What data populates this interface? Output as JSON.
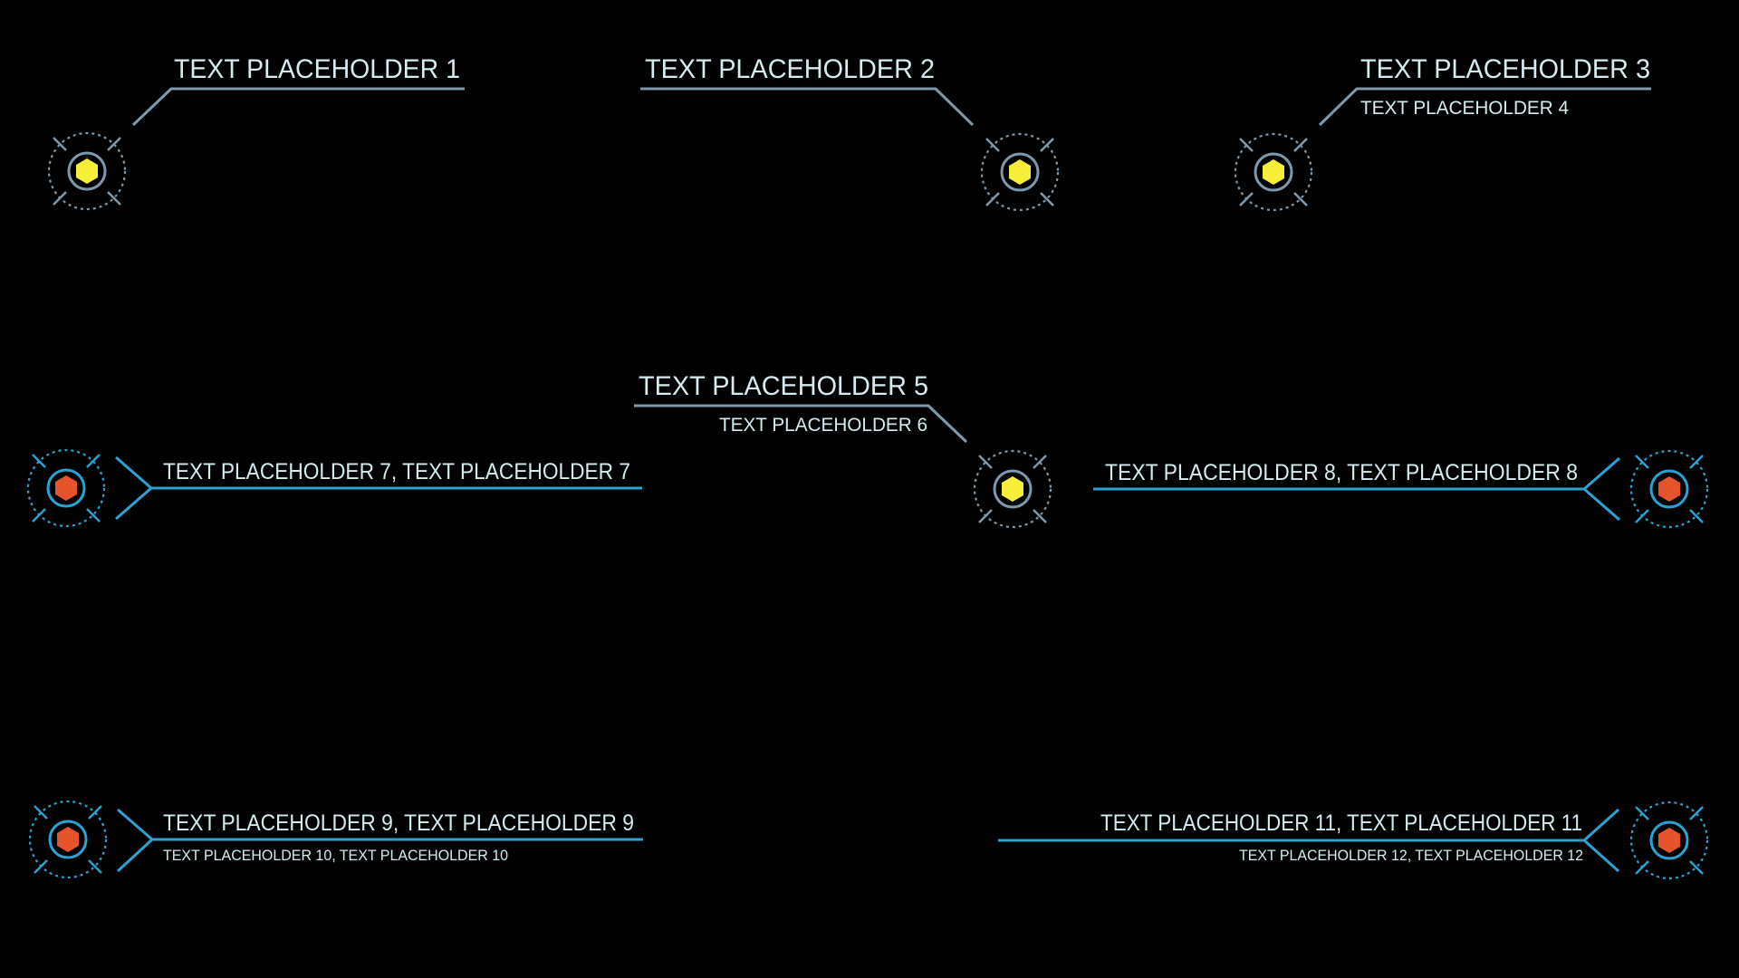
{
  "theme": {
    "background": "#000000",
    "text_color": "#d4ecf0",
    "leader_gray": "#7e99ad",
    "leader_blue": "#2aa3d4",
    "marker_yellow": "#f7ee3a",
    "marker_orange": "#e6542c"
  },
  "callouts": [
    {
      "id": 1,
      "title": "TEXT PLACEHOLDER 1",
      "marker": "yellow-hexagon-target-icon"
    },
    {
      "id": 2,
      "title": "TEXT PLACEHOLDER 2",
      "marker": "yellow-hexagon-target-icon"
    },
    {
      "id": 3,
      "title": "TEXT PLACEHOLDER 3",
      "subtitle": "TEXT PLACEHOLDER 4",
      "marker": "yellow-hexagon-target-icon"
    },
    {
      "id": 5,
      "title": "TEXT PLACEHOLDER 5",
      "subtitle": "TEXT PLACEHOLDER 6",
      "marker": "yellow-hexagon-target-icon"
    },
    {
      "id": 7,
      "title": "TEXT PLACEHOLDER 7, TEXT PLACEHOLDER 7",
      "marker": "orange-hexagon-target-icon"
    },
    {
      "id": 8,
      "title": "TEXT PLACEHOLDER 8, TEXT PLACEHOLDER 8",
      "marker": "orange-hexagon-target-icon"
    },
    {
      "id": 9,
      "title": "TEXT PLACEHOLDER 9, TEXT PLACEHOLDER 9",
      "subtitle": "TEXT PLACEHOLDER 10, TEXT PLACEHOLDER 10",
      "marker": "orange-hexagon-target-icon"
    },
    {
      "id": 11,
      "title": "TEXT PLACEHOLDER 11, TEXT PLACEHOLDER 11",
      "subtitle": "TEXT PLACEHOLDER 12, TEXT PLACEHOLDER 12",
      "marker": "orange-hexagon-target-icon"
    }
  ]
}
